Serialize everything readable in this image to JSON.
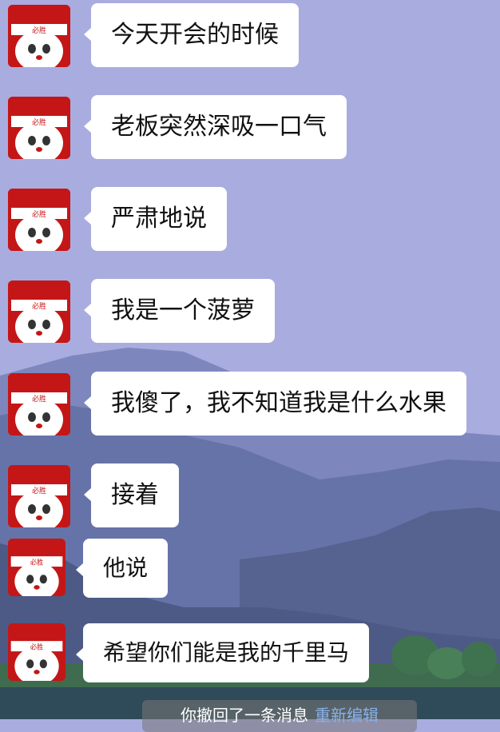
{
  "messages": [
    {
      "text": "今天开会的时候"
    },
    {
      "text": "老板突然深吸一口气"
    },
    {
      "text": "严肃地说"
    },
    {
      "text": "我是一个菠萝"
    },
    {
      "text": "我傻了，我不知道我是什么水果"
    },
    {
      "text": "接着"
    },
    {
      "text": "他说"
    },
    {
      "text": "希望你们能是我的千里马"
    }
  ],
  "avatar": {
    "headband_text": "必胜"
  },
  "recall_notice": {
    "text": "你撤回了一条消息",
    "edit_label": "重新编辑"
  },
  "colors": {
    "sky": "#a9acdf",
    "mountain": "#5d6aa0",
    "bubble": "#ffffff",
    "avatar_red": "#c41616",
    "edit_link": "#8ab0e8"
  }
}
